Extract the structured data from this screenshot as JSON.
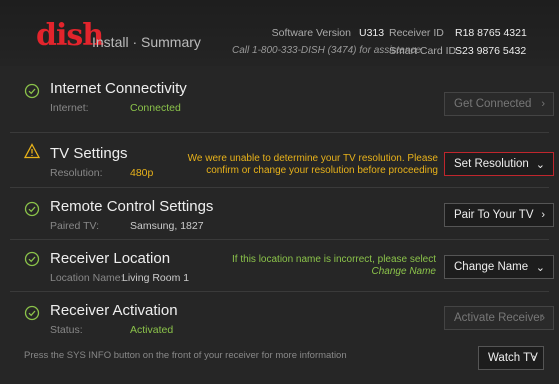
{
  "header": {
    "logo": "dish",
    "subtitle": "Install · Summary",
    "help_text": "Call 1-800-333-DISH (3474) for assistance",
    "software_version_label": "Software Version",
    "software_version": "U313",
    "receiver_id_label": "Receiver ID",
    "receiver_id": "R18 8765 4321",
    "smart_card_label": "Smart Card ID",
    "smart_card_id": "S23 9876 5432"
  },
  "rows": [
    {
      "title": "Internet Connectivity",
      "label": "Internet:",
      "value": "Connected",
      "status": "ok",
      "button": "Get Connected",
      "message": ""
    },
    {
      "title": "TV Settings",
      "label": "Resolution:",
      "value": "480p",
      "status": "warning",
      "button": "Set Resolution",
      "message_line1": "We were unable to determine your TV resolution. Please",
      "message_line2": "confirm or change your resolution before proceeding"
    },
    {
      "title": "Remote Control Settings",
      "label": "Paired TV:",
      "value": "Samsung, 1827",
      "status": "ok",
      "button": "Pair To Your TV"
    },
    {
      "title": "Receiver Location",
      "label": "Location Name:",
      "value": "Living Room 1",
      "status": "ok",
      "button": "Change Name",
      "message_line1": "If this location name is incorrect, please select",
      "message_line2": "Change Name"
    },
    {
      "title": "Receiver Activation",
      "label": "Status:",
      "value": "Activated",
      "status": "ok",
      "button": "Activate Receiver"
    }
  ],
  "footer": {
    "note": "Press the SYS INFO button on the front of your receiver for more information",
    "watch_button": "Watch TV"
  },
  "colors": {
    "ok": "#8bc34a",
    "warning": "#e8b21a",
    "brand": "#e2242c"
  }
}
